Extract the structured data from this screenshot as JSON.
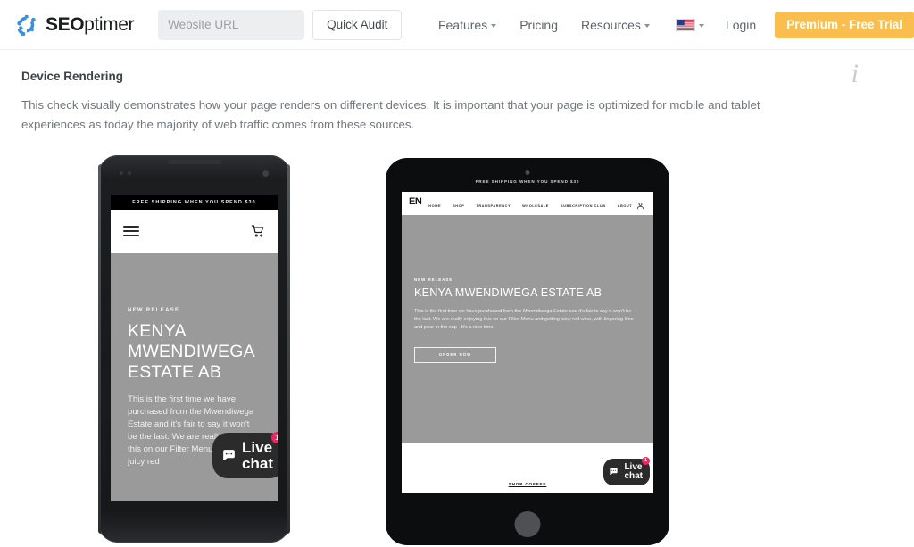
{
  "header": {
    "brand": {
      "bold": "SEO",
      "regular": "ptimer",
      "icon": "seoptimer-logo-icon"
    },
    "url_placeholder": "Website URL",
    "url_value": "",
    "quick_audit_label": "Quick Audit",
    "nav": [
      {
        "label": "Features",
        "has_caret": true
      },
      {
        "label": "Pricing",
        "has_caret": false
      },
      {
        "label": "Resources",
        "has_caret": true
      }
    ],
    "language_flag": "us-flag-icon",
    "login_label": "Login",
    "premium_label": "Premium - Free Trial",
    "premium_color": "#fabe4f"
  },
  "section": {
    "title": "Device Rendering",
    "description": "This check visually demonstrates how your page renders on different devices. It is important that your page is optimized for mobile and tablet experiences as today the majority of web traffic comes from these sources.",
    "info_icon": "info-icon"
  },
  "site": {
    "shipping_banner": "FREE SHIPPING WHEN YOU SPEND $30",
    "logo": "EN",
    "nav_links": [
      "HOME",
      "SHOP",
      "TRANSPARENCY",
      "WHOLESALE",
      "SUBSCRIPTION CLUB",
      "ABOUT"
    ],
    "hero": {
      "eyebrow": "NEW RELEASE",
      "title_phone_lines": [
        "KENYA",
        "MWENDIWEGA",
        "ESTATE AB"
      ],
      "title": "KENYA MWENDIWEGA ESTATE AB",
      "body_phone": "This is the first time we have purchased from the Mwendiwega Estate and it's fair to say it won't be the last. We are really enjoying this on our Filter Menu and getting juicy red",
      "body_tablet": "This is the first time we have purchased from the Mwendiwega Estate and it's fair to say it won't be the last. We are really enjoying this on our Filter Menu and getting juicy red wine, with lingering lime and pear in the cup - It's a nice time.",
      "cta_label": "ORDER NOW",
      "background_color": "#9a9a9a"
    },
    "footer_link": "SHOP COFFEE",
    "live_chat": {
      "line1": "Live",
      "line2": "chat",
      "badge": "1",
      "badge_color": "#f2255f",
      "background": "#2b2b2b"
    }
  },
  "devices": {
    "phone_label": "phone-mockup",
    "tablet_label": "tablet-mockup"
  }
}
